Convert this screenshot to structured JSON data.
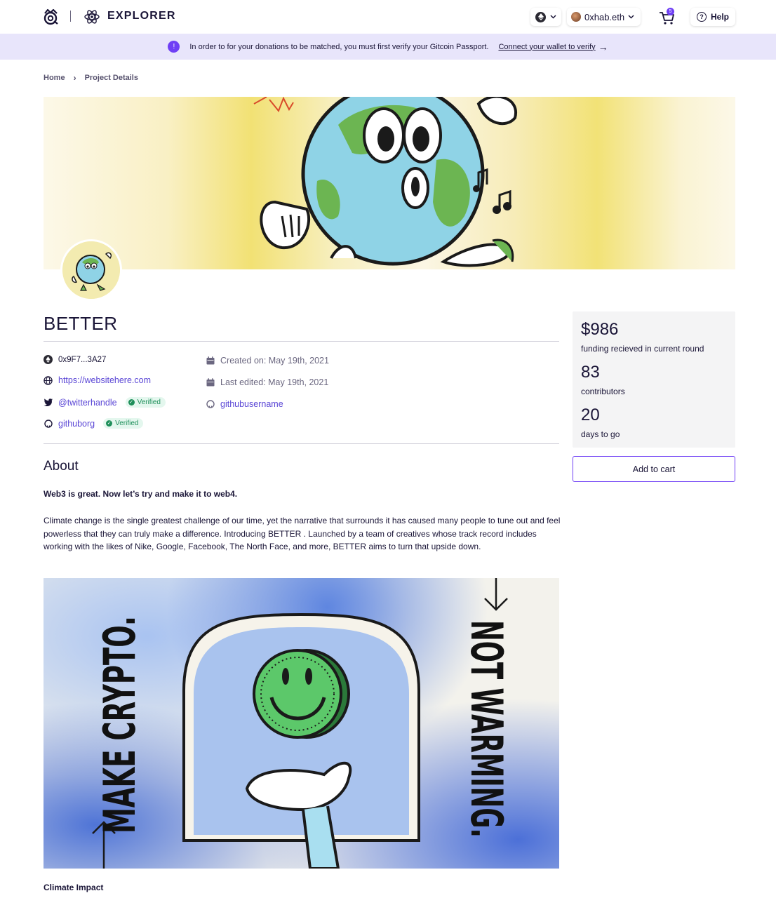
{
  "header": {
    "brand": "EXPLORER",
    "wallet_name": "0xhab.eth",
    "cart_count": "5",
    "help_label": "Help"
  },
  "notice": {
    "message": "In order to for your donations to be matched, you must first verify your Gitcoin Passport.",
    "link": "Connect your wallet to verify"
  },
  "breadcrumb": {
    "home": "Home",
    "current": "Project Details"
  },
  "project": {
    "title": "BETTER",
    "address": "0x9F7...3A27",
    "website": "https://websitehere.com",
    "twitter": "@twitterhandle",
    "twitter_status": "Verified",
    "github_org": "githuborg",
    "github_org_status": "Verified",
    "created_on": "Created on: May 19th, 2021",
    "last_edited": "Last edited: May 19th, 2021",
    "github_user": "githubusername"
  },
  "about": {
    "heading": "About",
    "tagline": "Web3 is great. Now let’s try and make it to web4.",
    "description": "Climate change is the single greatest challenge of our time, yet the narrative that surrounds it has caused many people to tune out and feel powerless that they can truly make a difference.  Introducing BETTER .  Launched by a team of creatives whose track record includes working with the likes of Nike, Google, Facebook, The North Face, and more, BETTER aims to turn that upside down.",
    "poster_left": "MAKE CRYPTO.",
    "poster_right": "NOT WARMING.",
    "section2": "Climate Impact"
  },
  "stats": {
    "funding_value": "$986",
    "funding_label": "funding recieved in current round",
    "contributors_value": "83",
    "contributors_label": "contributors",
    "days_value": "20",
    "days_label": "days to go"
  },
  "actions": {
    "add_to_cart": "Add to cart"
  },
  "colors": {
    "accent": "#6f3ff5",
    "link": "#5b47d6",
    "notice_bg": "#e8e5fb",
    "verified": "#1e8f5a"
  }
}
